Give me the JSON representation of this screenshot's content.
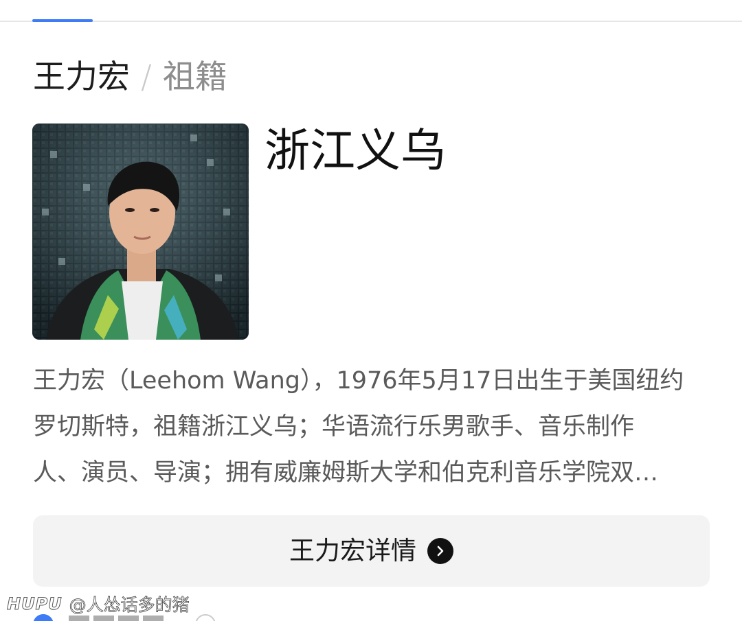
{
  "header": {
    "entity": "王力宏",
    "separator": "/",
    "attribute": "祖籍"
  },
  "answer": "浙江义乌",
  "summary": {
    "lines": [
      "王力宏（Leehom Wang），1976年5月17日出生于美国纽约",
      "罗切斯特，祖籍浙江义乌；华语流行乐男歌手、音乐制作",
      "人、演员、导演；拥有威廉姆斯大学和伯克利音乐学院双…"
    ]
  },
  "detail_button": {
    "label": "王力宏详情",
    "icon": "chevron-right-icon"
  },
  "watermark": {
    "brand": "HUPU",
    "user": "@人怂话多的猪"
  },
  "colors": {
    "accent": "#3d7bf7",
    "text_primary": "#111111",
    "text_secondary": "#5a5a5a",
    "button_bg": "#f3f3f3"
  }
}
